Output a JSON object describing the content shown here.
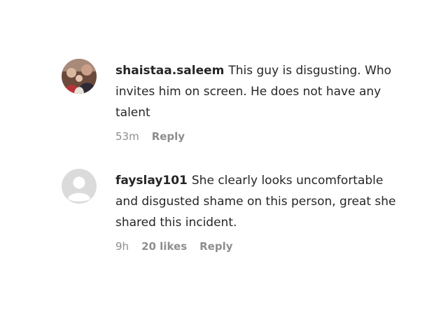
{
  "comments": [
    {
      "username": "shaistaa.saleem",
      "text": "This guy is disgusting. Who invites him on screen. He does not have any talent",
      "time": "53m",
      "reply_label": "Reply"
    },
    {
      "username": "fayslay101",
      "text": "She clearly looks uncomfortable and disgusted shame on this person, great she shared this incident.",
      "time": "9h",
      "likes": "20 likes",
      "reply_label": "Reply"
    }
  ],
  "colors": {
    "text": "#262626",
    "meta": "#8e8e8e",
    "default_avatar_bg": "#dbdbdb",
    "default_avatar_fg": "#ffffff"
  }
}
